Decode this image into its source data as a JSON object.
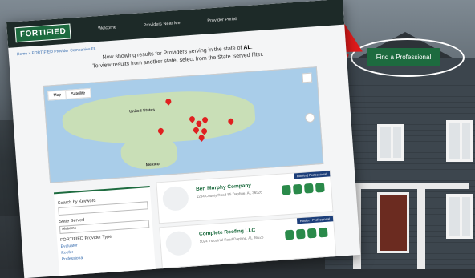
{
  "cta": {
    "label": "Find a Professional"
  },
  "nav": {
    "logo": "FORTIFIED",
    "items": [
      "Welcome",
      "Providers Near Me",
      "Provider Portal"
    ]
  },
  "breadcrumb": "Home » FORTIFIED Provider Companies FL",
  "heading": {
    "line1_prefix": "Now showing results for Providers serving in the state of",
    "state": "AL",
    "line2": "To view results from another state, select from the State Served filter."
  },
  "map": {
    "tabs": [
      "Map",
      "Satellite"
    ],
    "labels": [
      "United States",
      "Mexico"
    ]
  },
  "filters": {
    "search_label": "Search by Keyword",
    "state_label": "State Served",
    "state_value": "Alabama",
    "type_label": "FORTIFIED Provider Type",
    "options": [
      "Evaluator",
      "Roofer",
      "Professional"
    ]
  },
  "results": [
    {
      "name": "Ben Murphy Company",
      "address": "1234 County Road 85 Daphne, AL 36526",
      "tags": "Roofer | Professional"
    },
    {
      "name": "Complete Roofing LLC",
      "address": "1024 Industrial Road Daphne, AL 36526",
      "tags": "Roofer | Professional"
    }
  ],
  "colors": {
    "brand_green": "#1d6b3f",
    "annotation_red": "#e21a1a"
  }
}
